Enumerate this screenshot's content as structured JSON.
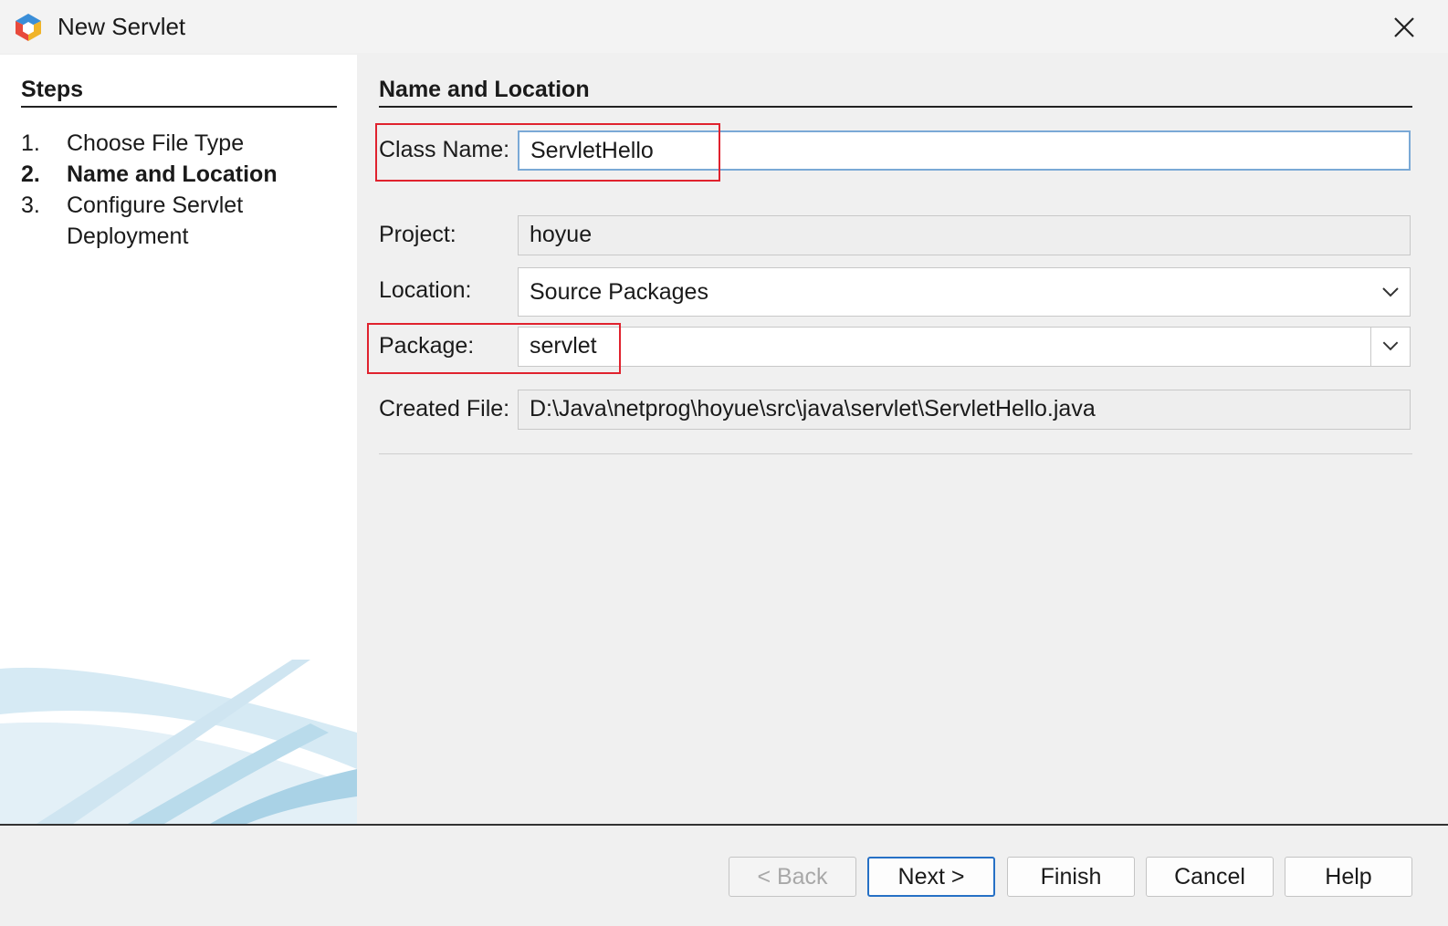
{
  "window": {
    "title": "New Servlet",
    "app_icon": "netbeans-cube-icon",
    "close_icon": "close-icon"
  },
  "steps": {
    "title": "Steps",
    "items": [
      {
        "num": "1.",
        "label": "Choose File Type",
        "active": false
      },
      {
        "num": "2.",
        "label": "Name and Location",
        "active": true
      },
      {
        "num": "3.",
        "label": "Configure Servlet",
        "active": false
      },
      {
        "num": "",
        "label": "Deployment",
        "active": false
      }
    ]
  },
  "section": {
    "title": "Name and Location"
  },
  "form": {
    "class_name_label": "Class Name:",
    "class_name_value": "ServletHello",
    "project_label": "Project:",
    "project_value": "hoyue",
    "location_label": "Location:",
    "location_value": "Source Packages",
    "package_label": "Package:",
    "package_value": "servlet",
    "created_file_label": "Created File:",
    "created_file_value": "D:\\Java\\netprog\\hoyue\\src\\java\\servlet\\ServletHello.java"
  },
  "buttons": {
    "back": "< Back",
    "next": "Next >",
    "finish": "Finish",
    "cancel": "Cancel",
    "help": "Help"
  },
  "colors": {
    "highlight": "#e0222e",
    "focus_border": "#7aa9d6",
    "default_button_border": "#2670c5"
  }
}
